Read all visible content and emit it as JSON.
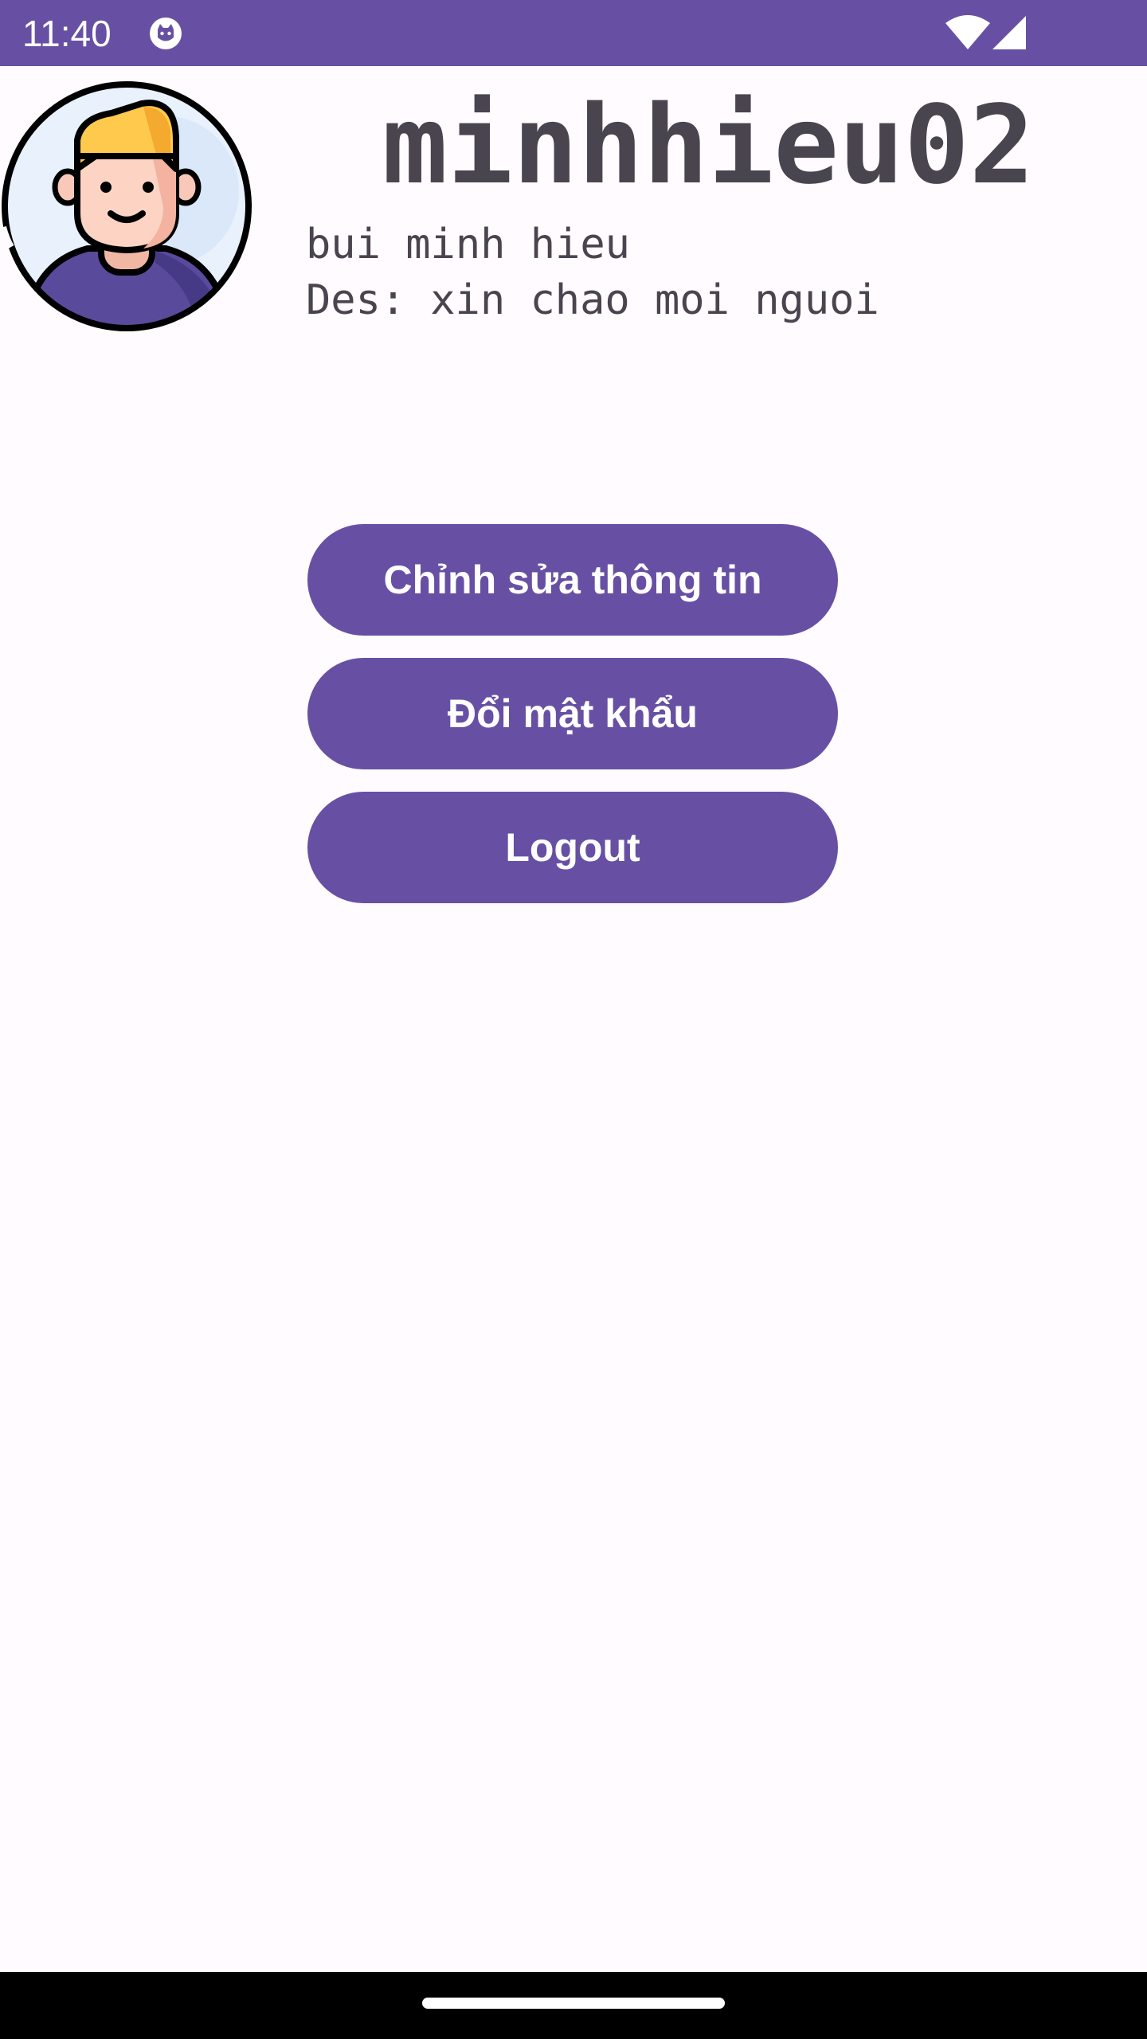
{
  "status_bar": {
    "time": "11:40",
    "background": "#6750a4",
    "icons": [
      "cat-app-icon",
      "wifi-icon",
      "signal-icon"
    ]
  },
  "profile": {
    "avatar_icon": "user-avatar-icon",
    "username": "minhhieu02",
    "full_name": "bui minh hieu",
    "description_label": "Des:",
    "description": "xin chao moi nguoi"
  },
  "actions": {
    "edit_profile": "Chỉnh sửa thông tin",
    "change_password": "Đổi mật khẩu",
    "logout": "Logout"
  },
  "colors": {
    "primary": "#6750a4",
    "background": "#fffbfe",
    "text": "#49454f"
  }
}
